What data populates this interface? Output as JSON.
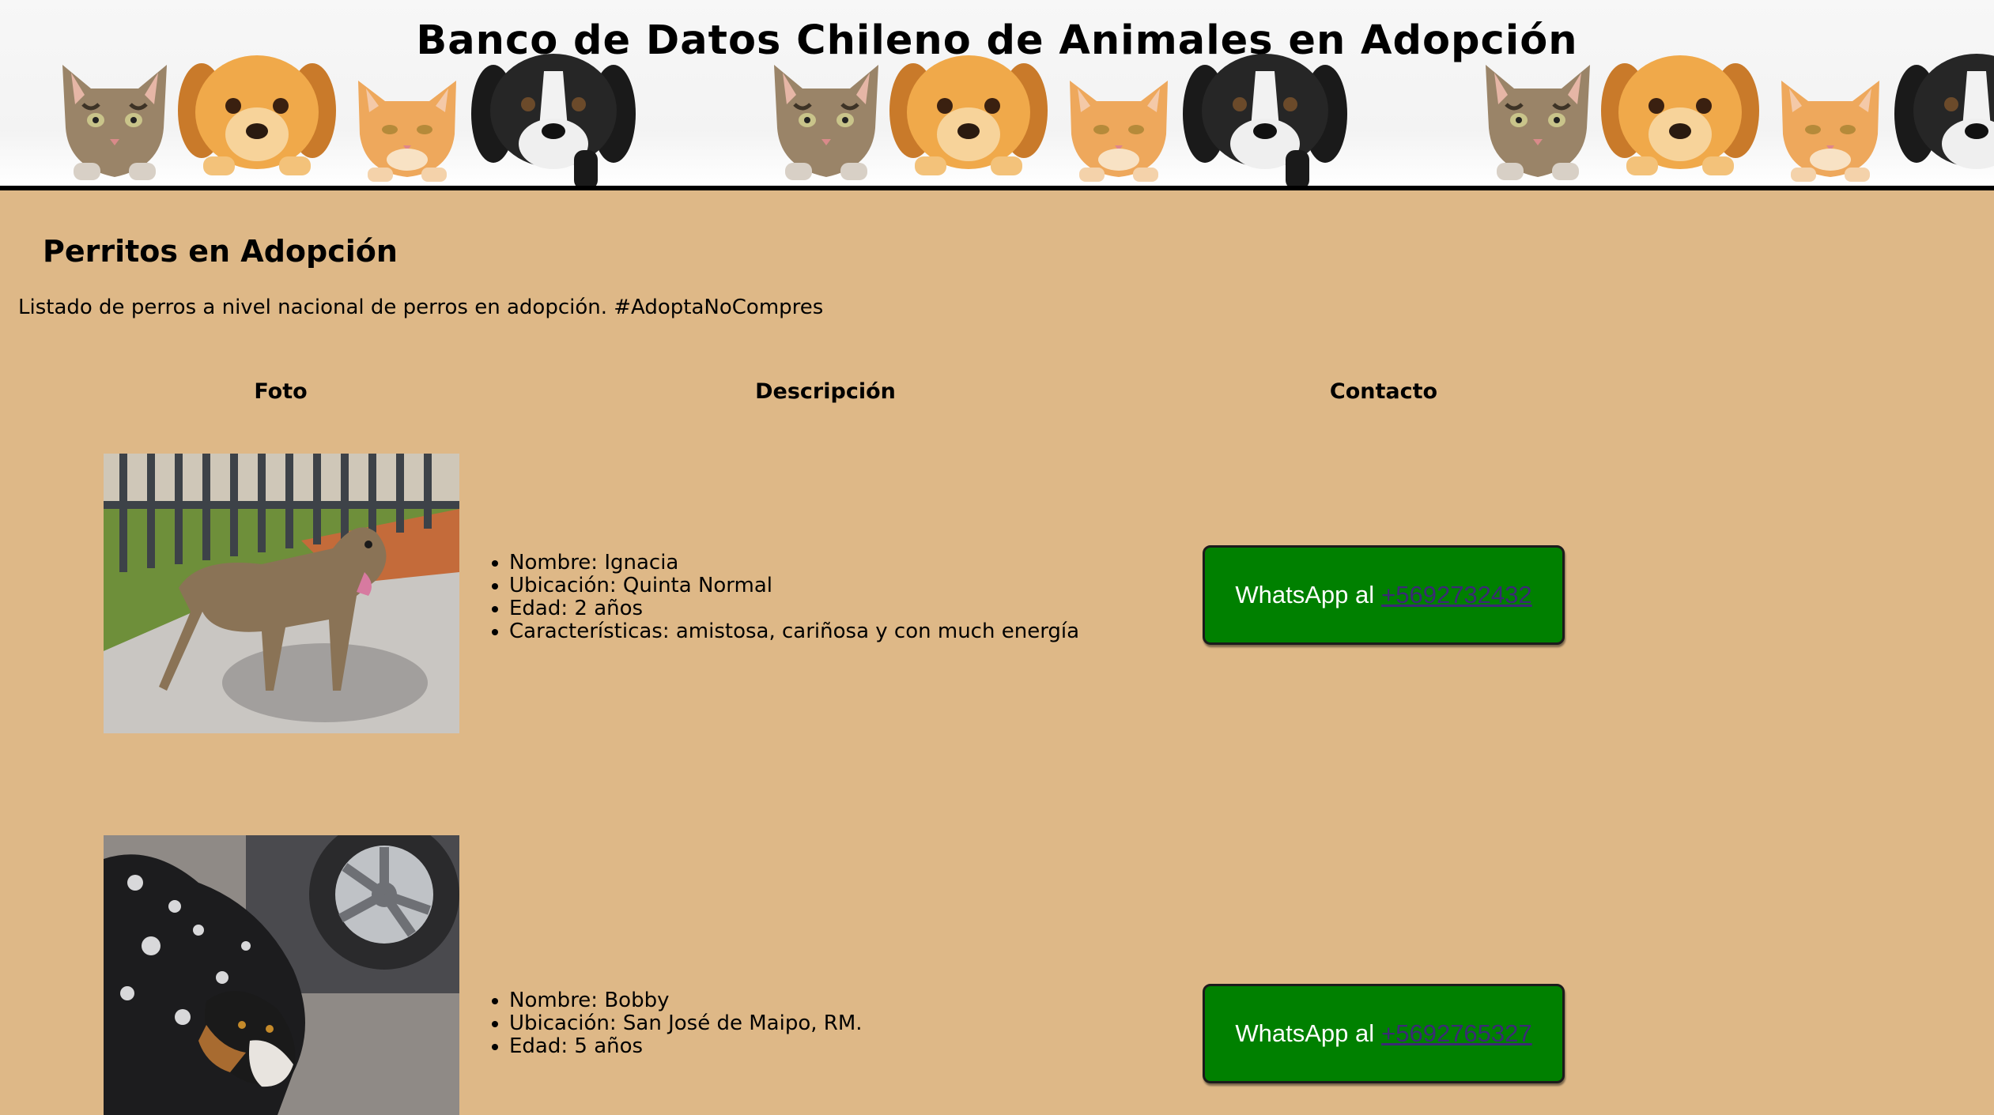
{
  "header": {
    "title": "Banco de Datos Chileno de Animales en Adopción"
  },
  "section": {
    "title": "Perritos en Adopción",
    "intro": "Listado de perros a nivel nacional de perros en adopción. #AdoptaNoCompres"
  },
  "table": {
    "headers": [
      "Foto",
      "Descripción",
      "Contacto"
    ]
  },
  "dogs": [
    {
      "nombre": "Nombre: Ignacia",
      "ubicacion": "Ubicación: Quinta Normal",
      "edad": "Edad: 2 años",
      "caracteristicas": "Características: amistosa, cariñosa y con much energía",
      "whatsapp_prefix": "WhatsApp al",
      "phone": "+5692732432"
    },
    {
      "nombre": "Nombre: Bobby",
      "ubicacion": "Ubicación: San José de Maipo, RM.",
      "edad": "Edad: 5 años",
      "whatsapp_prefix": "WhatsApp al",
      "phone": "+5692765327"
    }
  ],
  "colors": {
    "page_background": "#deb887",
    "button_green": "#008000",
    "link_color": "#3b2a75"
  }
}
